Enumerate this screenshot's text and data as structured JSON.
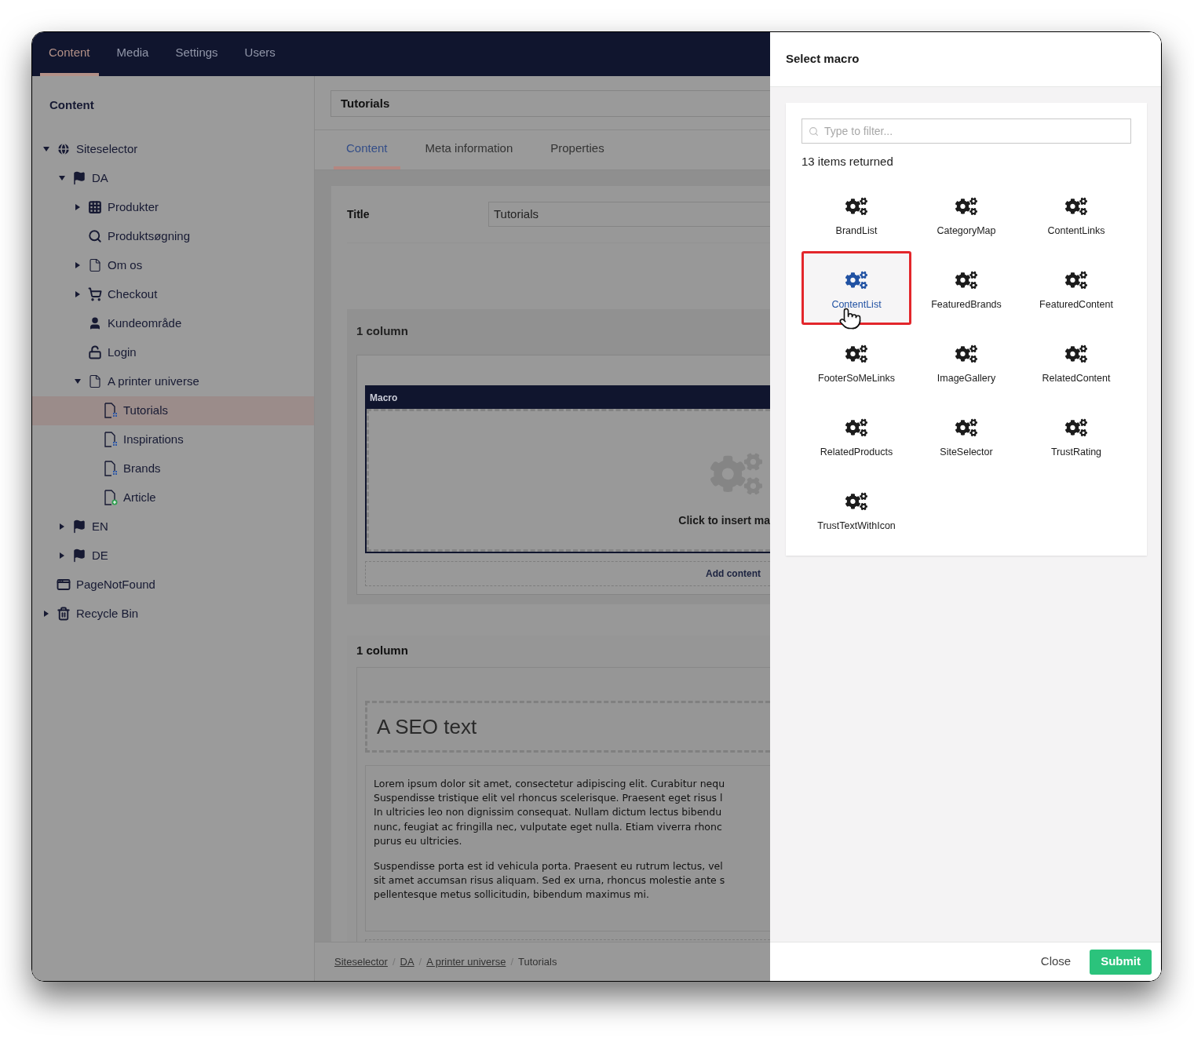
{
  "top_nav": [
    {
      "label": "Content",
      "selected": true
    },
    {
      "label": "Media",
      "selected": false
    },
    {
      "label": "Settings",
      "selected": false
    },
    {
      "label": "Users",
      "selected": false
    }
  ],
  "sidebar": {
    "heading": "Content",
    "tree": [
      {
        "label": "Siteselector",
        "kind": "globe",
        "expandable": true,
        "expanded": true,
        "selected": false,
        "children": [
          {
            "label": "DA",
            "kind": "flag",
            "expandable": true,
            "expanded": true,
            "selected": false,
            "children": [
              {
                "label": "Produkter",
                "kind": "grid",
                "expandable": true,
                "expanded": false,
                "selected": false
              },
              {
                "label": "Produktsøgning",
                "kind": "search",
                "expandable": false,
                "selected": false
              },
              {
                "label": "Om os",
                "kind": "page",
                "expandable": true,
                "expanded": false,
                "selected": false
              },
              {
                "label": "Checkout",
                "kind": "cart",
                "expandable": true,
                "expanded": false,
                "selected": false
              },
              {
                "label": "Kundeområde",
                "kind": "member",
                "expandable": false,
                "selected": false
              },
              {
                "label": "Login",
                "kind": "unlock",
                "expandable": false,
                "selected": false
              },
              {
                "label": "A printer universe",
                "kind": "page",
                "expandable": true,
                "expanded": true,
                "selected": false,
                "children": [
                  {
                    "label": "Tutorials",
                    "kind": "list-page",
                    "expandable": false,
                    "selected": true
                  },
                  {
                    "label": "Inspirations",
                    "kind": "list-page",
                    "expandable": false,
                    "selected": false
                  },
                  {
                    "label": "Brands",
                    "kind": "list-page",
                    "expandable": false,
                    "selected": false
                  },
                  {
                    "label": "Article",
                    "kind": "new-page",
                    "expandable": false,
                    "selected": false
                  }
                ]
              }
            ]
          },
          {
            "label": "EN",
            "kind": "flag",
            "expandable": true,
            "expanded": false,
            "selected": false
          },
          {
            "label": "DE",
            "kind": "flag",
            "expandable": true,
            "expanded": false,
            "selected": false
          }
        ]
      },
      {
        "label": "PageNotFound",
        "kind": "error-page",
        "expandable": false,
        "selected": false
      },
      {
        "label": "Recycle Bin",
        "kind": "bin",
        "expandable": true,
        "expanded": false,
        "selected": false
      }
    ]
  },
  "editor": {
    "name_field": "Tutorials",
    "tabs": [
      {
        "label": "Content",
        "selected": true
      },
      {
        "label": "Meta information",
        "selected": false
      },
      {
        "label": "Properties",
        "selected": false
      }
    ],
    "title_label": "Title",
    "title_value": "Tutorials",
    "sections": [
      {
        "kind": "macro",
        "heading": "1 column",
        "macro_label": "Macro",
        "prompt": "Click to insert ma",
        "add_label": "Add content"
      },
      {
        "kind": "text",
        "heading": "1 column",
        "seo_heading": "A SEO text",
        "paragraphs": [
          [
            "Lorem ipsum dolor sit amet, consectetur adipiscing elit. Curabitur nequ",
            "Suspendisse tristique elit vel rhoncus scelerisque. Praesent eget risus l",
            "In ultricies leo non dignissim consequat. Nullam dictum lectus bibendu",
            "nunc, feugiat ac fringilla nec, vulputate eget nulla. Etiam viverra rhonc",
            "purus eu ultricies."
          ],
          [
            "Suspendisse porta est id vehicula porta. Praesent eu rutrum lectus, vel",
            "sit amet accumsan risus aliquam. Sed ex urna, rhoncus molestie ante s",
            "pellentesque metus sollicitudin, bibendum maximus mi."
          ]
        ]
      }
    ],
    "breadcrumb": [
      {
        "label": "Siteselector",
        "link": true,
        "separator": "/"
      },
      {
        "label": "DA",
        "link": true,
        "separator": "/"
      },
      {
        "label": "A printer universe",
        "link": true,
        "separator": "/"
      },
      {
        "label": "Tutorials",
        "link": false
      }
    ]
  },
  "dialog": {
    "title": "Select macro",
    "filter_placeholder": "Type to filter...",
    "count": "13 items returned",
    "macros": [
      {
        "label": "BrandList",
        "selected": false
      },
      {
        "label": "CategoryMap",
        "selected": false
      },
      {
        "label": "ContentLinks",
        "selected": false
      },
      {
        "label": "ContentList",
        "selected": true
      },
      {
        "label": "FeaturedBrands",
        "selected": false
      },
      {
        "label": "FeaturedContent",
        "selected": false
      },
      {
        "label": "FooterSoMeLinks",
        "selected": false
      },
      {
        "label": "ImageGallery",
        "selected": false
      },
      {
        "label": "RelatedContent",
        "selected": false
      },
      {
        "label": "RelatedProducts",
        "selected": false
      },
      {
        "label": "SiteSelector",
        "selected": false
      },
      {
        "label": "TrustRating",
        "selected": false
      },
      {
        "label": "TrustTextWithIcon",
        "selected": false
      }
    ],
    "close_label": "Close",
    "submit_label": "Submit"
  }
}
